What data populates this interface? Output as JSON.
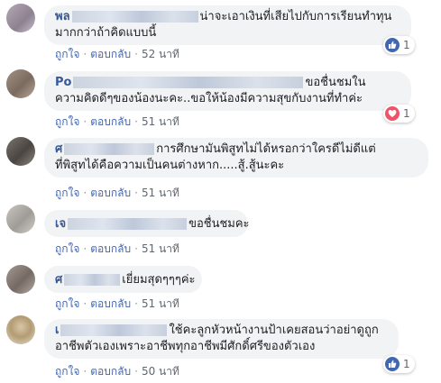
{
  "comments": [
    {
      "author": "พล",
      "line1": "น่าจะเอาเงินที่เสียไปกับการเรียนทำทุน",
      "line2": "มากกว่าถ้าคิดแบบนี้",
      "like": "ถูกใจ",
      "reply": "ตอบกลับ",
      "time": "52 นาที",
      "reaction": {
        "type": "like",
        "count": "1"
      },
      "avatar_color": "#9a8e9c"
    },
    {
      "author": "Po",
      "line1": "ขอชื่นชมใน",
      "line2": "ความคิดดีๆของน้องนะคะ..ขอให้น้องมีความสุขกับงานที่ทำค่ะ",
      "like": "ถูกใจ",
      "reply": "ตอบกลับ",
      "time": "51 นาที",
      "reaction": {
        "type": "love",
        "count": "1"
      },
      "avatar_color": "#8c7b70"
    },
    {
      "author": "ศ",
      "line1": "การศึกษามันพิสูทไม่ได้หรอกว่าใครดีไม่ดีแต่",
      "line2": "ที่พิสูทได้คือความเป็นคนต่างหาก.....สู้.สู้นะคะ",
      "like": "ถูกใจ",
      "reply": "ตอบกลับ",
      "time": "51 นาที",
      "avatar_color": "#5f5a55"
    },
    {
      "author": "เจ",
      "line1": "ขอชื่นชมคะ",
      "like": "ถูกใจ",
      "reply": "ตอบกลับ",
      "time": "51 นาที",
      "avatar_color": "#a9a6a2"
    },
    {
      "author": "ศ",
      "line1": "เยี่ยมสุดๆๆๆค่ะ",
      "like": "ถูกใจ",
      "reply": "ตอบกลับ",
      "time": "51 นาที",
      "avatar_color": "#8a7f7a"
    },
    {
      "author": "เ",
      "line1": "ใช้คะลูกหัวหน้างานป้าเคยสอนว่าอย่าดูถูก",
      "line2": "อาชีพตัวเองเพราะอาชีพทุกอาชีพมีศักดิ์ศรีของตัวเอง",
      "like": "ถูกใจ",
      "reply": "ตอบกลับ",
      "time": "50 นาที",
      "reaction": {
        "type": "like",
        "count": "1"
      },
      "avatar_color": "#b7a27e"
    }
  ],
  "colors": {
    "link": "#4267b2",
    "author": "#385898",
    "bubble": "#f2f3f5",
    "like": "#4267b2",
    "love": "#f25268"
  }
}
